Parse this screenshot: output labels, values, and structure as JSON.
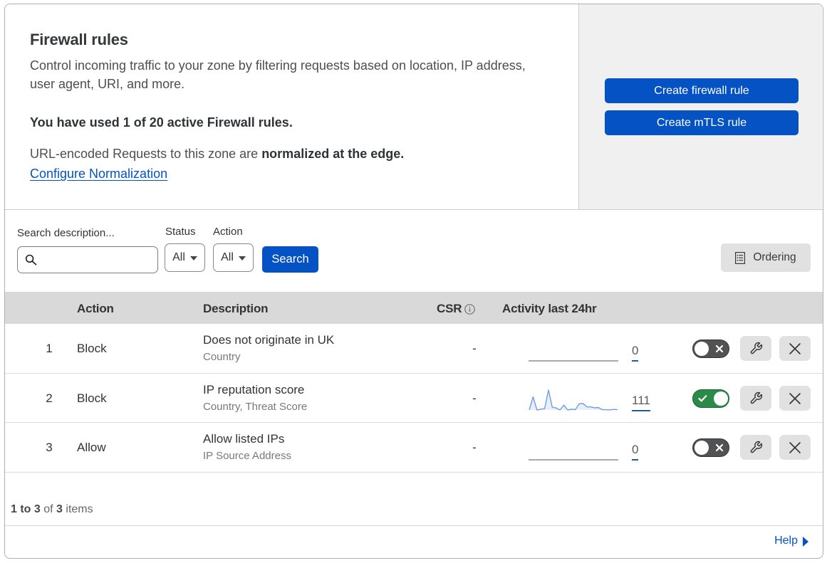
{
  "page": {
    "title": "Firewall rules",
    "description": "Control incoming traffic to your zone by filtering requests based on location, IP address, user agent, URI, and more.",
    "usage_line": "You have used 1 of 20 active Firewall rules.",
    "normalization_text": "URL-encoded Requests to this zone are ",
    "normalization_bold": "normalized at the edge.",
    "normalization_link": "Configure Normalization"
  },
  "actions_panel": {
    "create_firewall_rule_label": "Create firewall rule",
    "create_mtls_rule_label": "Create mTLS rule"
  },
  "filters": {
    "search_label": "Search description...",
    "search_value": "",
    "status_label": "Status",
    "status_value": "All",
    "action_label": "Action",
    "action_value": "All",
    "search_button_label": "Search",
    "ordering_button_label": "Ordering"
  },
  "table": {
    "headers": {
      "action": "Action",
      "description": "Description",
      "csr": "CSR",
      "activity": "Activity last 24hr"
    },
    "rows": [
      {
        "index": "1",
        "action": "Block",
        "title": "Does not originate in UK",
        "subtitle": "Country",
        "csr": "-",
        "activity_count": "0",
        "enabled": false
      },
      {
        "index": "2",
        "action": "Block",
        "title": "IP reputation score",
        "subtitle": "Country, Threat Score",
        "csr": "-",
        "activity_count": "111",
        "enabled": true
      },
      {
        "index": "3",
        "action": "Allow",
        "title": "Allow listed IPs",
        "subtitle": "IP Source Address",
        "csr": "-",
        "activity_count": "0",
        "enabled": false
      }
    ]
  },
  "footer": {
    "range_text": "1 to 3",
    "of_text": " of ",
    "total_text": "3",
    "items_text": " items",
    "help_label": "Help"
  },
  "chart_data": {
    "type": "area",
    "title": "Activity last 24hr sparkline (rule 2)",
    "x_hours": [
      0,
      1,
      2,
      3,
      4,
      5,
      6,
      7,
      8,
      9,
      10,
      11,
      12,
      13,
      14,
      15,
      16,
      17,
      18,
      19,
      20,
      21,
      22,
      23
    ],
    "values": [
      0,
      19,
      0,
      1,
      2,
      29,
      4,
      3,
      0,
      7,
      0,
      1,
      0.5,
      9,
      9.5,
      4.5,
      4.4,
      3.1,
      3.6,
      0.5,
      0.3,
      0.1,
      0.8,
      0.3
    ],
    "total": 111,
    "ylim": [
      0,
      30
    ],
    "line_color": "#6d9de5",
    "fill_color": "rgba(109,157,229,0.16)"
  },
  "colors": {
    "accent_blue": "#0452c3",
    "toggle_on_green": "#2a8a48",
    "toggle_off_gray": "#505254",
    "header_gray": "#d9d9d9",
    "panel_gray": "#f0f0f0"
  }
}
